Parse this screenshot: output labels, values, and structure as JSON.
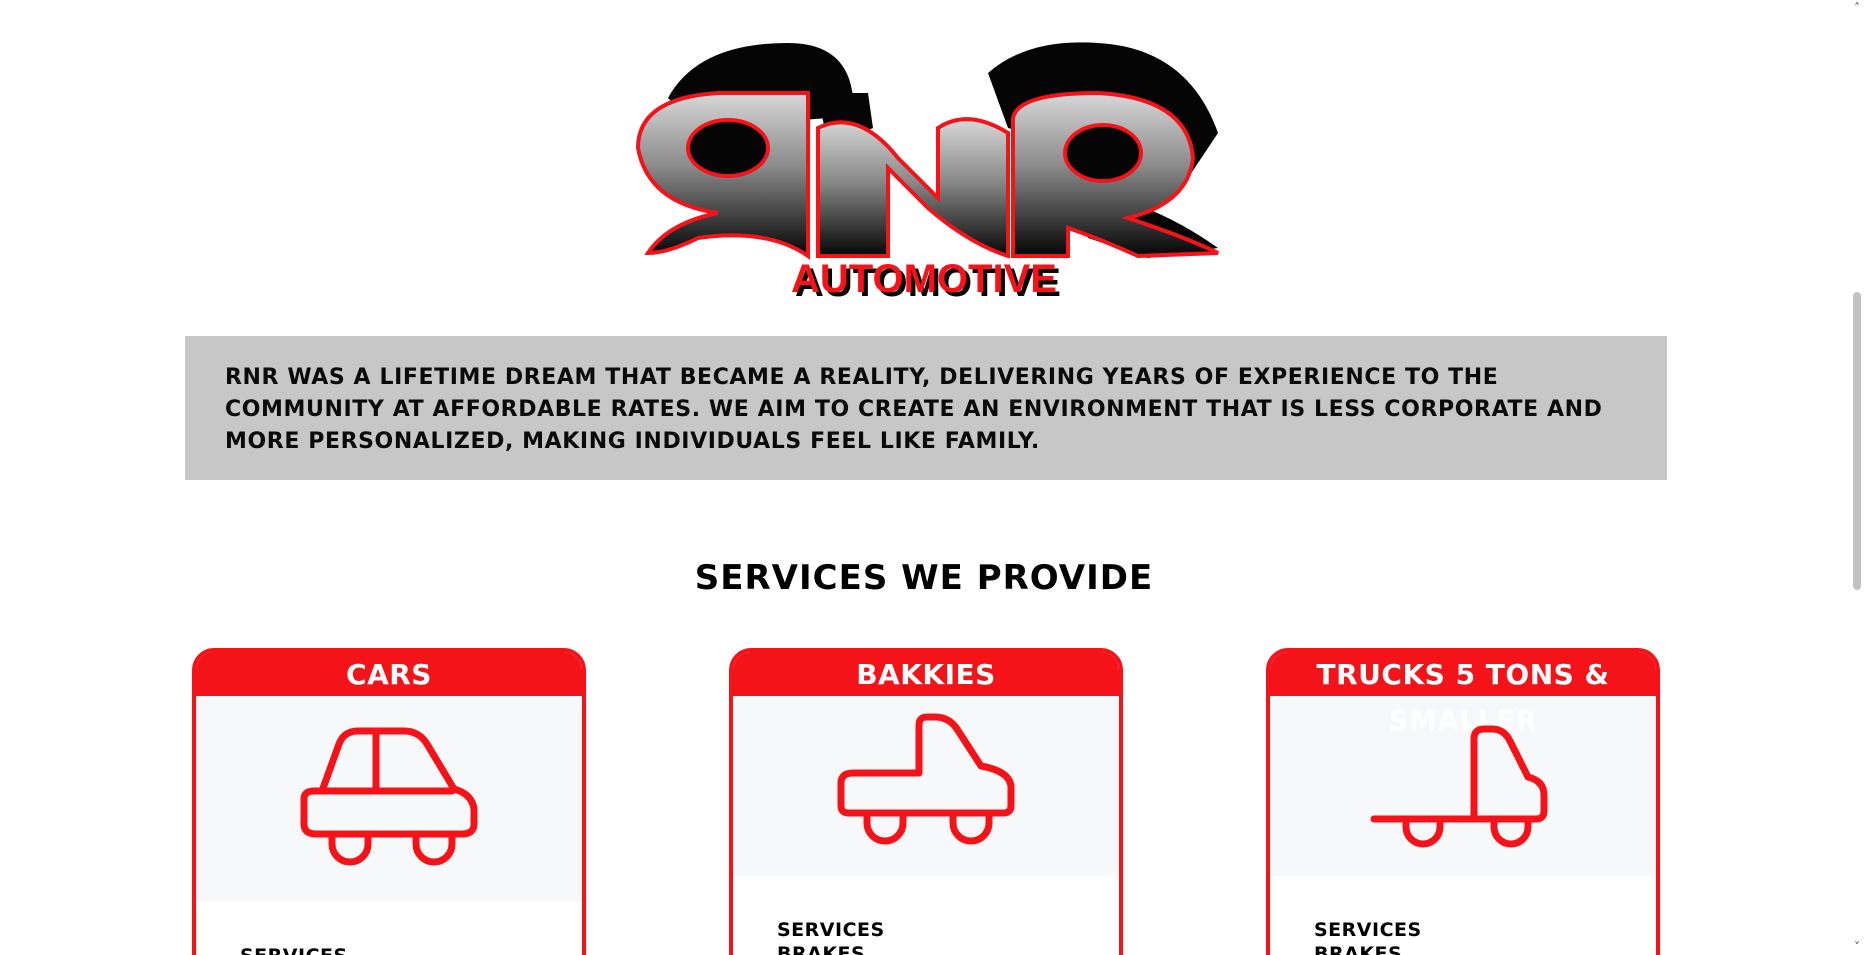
{
  "brand": {
    "logo_text": "RNR",
    "logo_subtext": "AUTOMOTIVE",
    "colors": {
      "red": "#f5131a",
      "gray_banner": "#c8c7c8",
      "black": "#000000"
    }
  },
  "about": {
    "text": "RNR was a lifetime dream that became a reality, delivering years of experience to the community at affordable rates. We aim to create an environment that is less corporate and more personalized, making individuals feel like family."
  },
  "services": {
    "title": "SERVICES WE PROVIDE",
    "cards": [
      {
        "title": "CARS",
        "icon": "car-icon",
        "items": [
          "SERVICES"
        ]
      },
      {
        "title": "BAKKIES",
        "icon": "bakkie-icon",
        "items": [
          "SERVICES",
          "BRAKES"
        ]
      },
      {
        "title": "TRUCKS 5 TONS & SMALLER",
        "icon": "truck-icon",
        "items": [
          "SERVICES",
          "BRAKES"
        ]
      }
    ]
  },
  "scrollbar": {
    "up_arrow": "˄",
    "down_arrow": "˅"
  }
}
